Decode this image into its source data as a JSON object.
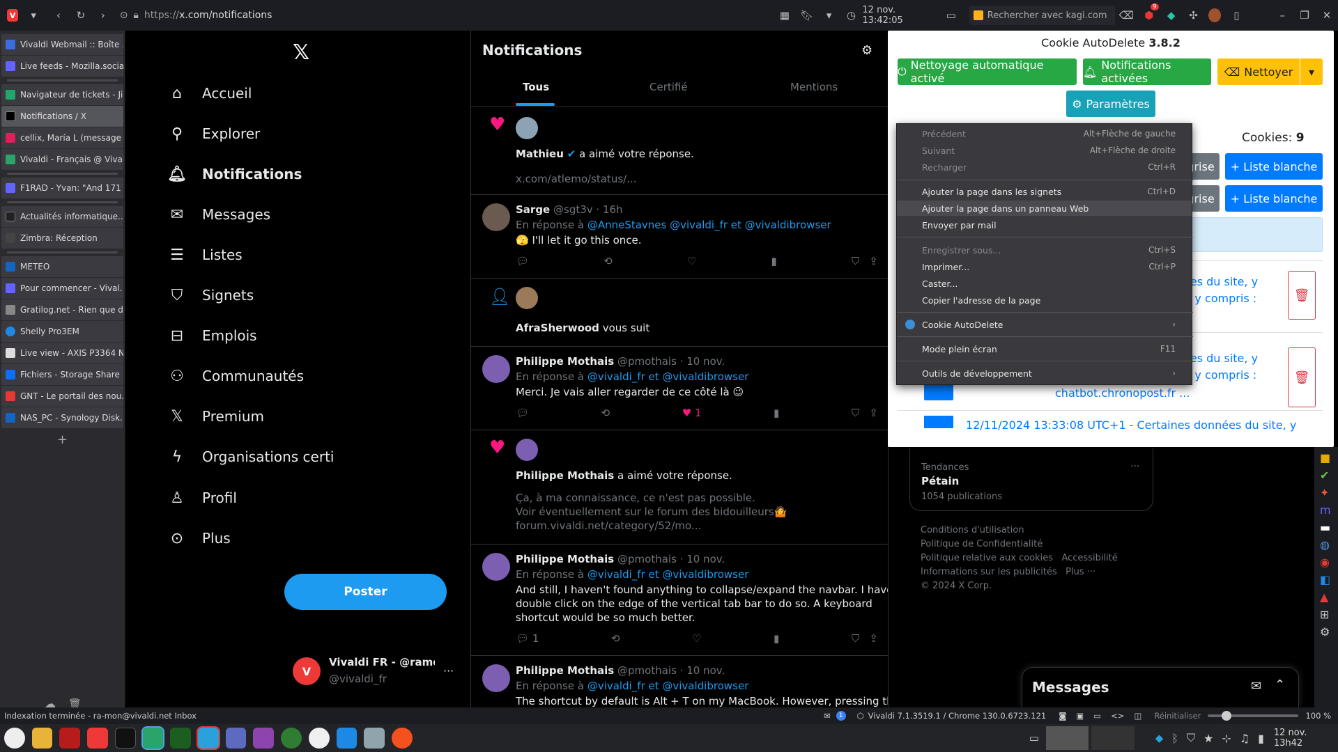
{
  "browser": {
    "url": "https://x.com/notifications",
    "url_prefix": "https://",
    "url_host": "x.com/notifications",
    "datetime": "12 nov. 13:42:05",
    "search_placeholder": "Rechercher avec kagi.com",
    "badge_count": "9"
  },
  "vtabs": [
    {
      "label": "Vivaldi Webmail :: Boîte ...",
      "color": "#3d6cdf"
    },
    {
      "label": "Live feeds - Mozilla.social",
      "color": "#6364ff"
    },
    {
      "label": "Navigateur de tickets - Ji...",
      "color": "#1fa86b"
    },
    {
      "label": "Notifications / X",
      "color": "#000000"
    },
    {
      "label": "cellix, María L (message ...",
      "color": "#e01e5a"
    },
    {
      "label": "Vivaldi - Français @ Vival...",
      "color": "#2aa46a"
    },
    {
      "label": "F1RAD - Yvan: \"And 171 l...",
      "color": "#6364ff"
    },
    {
      "label": "Actualités informatique...",
      "color": "#222222"
    },
    {
      "label": "Zimbra: Réception",
      "color": "#444444"
    },
    {
      "label": "METEO",
      "color": "#1565c0"
    },
    {
      "label": "Pour commencer - Vival...",
      "color": "#6364ff"
    },
    {
      "label": "Gratilog.net - Rien que d...",
      "color": "#888888"
    },
    {
      "label": "Shelly Pro3EM",
      "color": "#1e88e5"
    },
    {
      "label": "Live view - AXIS P3364 N...",
      "color": "#333333"
    },
    {
      "label": "Fichiers - Storage Share",
      "color": "#0d6efd"
    },
    {
      "label": "GNT - Le portail des nou...",
      "color": "#e53935"
    },
    {
      "label": "NAS_PC - Synology Disk...",
      "color": "#1565c0"
    }
  ],
  "nav": {
    "items": [
      "Accueil",
      "Explorer",
      "Notifications",
      "Messages",
      "Listes",
      "Signets",
      "Emplois",
      "Communautés",
      "Premium",
      "Organisations certi",
      "Profil",
      "Plus"
    ],
    "post_button": "Poster",
    "account_name": "Vivaldi FR - @ramon@",
    "account_handle": "@vivaldi_fr"
  },
  "feed": {
    "title": "Notifications",
    "tabs": [
      "Tous",
      "Certifié",
      "Mentions"
    ],
    "n1_name": "Mathieu",
    "n1_text": "a aimé votre réponse.",
    "n1_link": "x.com/atlemo/status/...",
    "p1_name": "Sarge",
    "p1_meta": "@sgt3v · 16h",
    "p1_reply_prefix": "En réponse à",
    "p1_reply_to": "@AnneStavnes @vivaldi_fr  et  @vivaldibrowser",
    "p1_body": "🫣 I'll let it go this once.",
    "n2_name": "AfraSherwood",
    "n2_text": "vous suit",
    "p2_name": "Philippe Mothais",
    "p2_meta": "@pmothais · 10 nov.",
    "p2_reply_to": "@vivaldi_fr  et  @vivaldibrowser",
    "p2_body": "Merci. Je vais aller regarder de ce côté là 😉",
    "p2_likes": "1",
    "n3_name": "Philippe Mothais",
    "n3_text": "a aimé votre réponse.",
    "n3_quote1": "Ça, à ma connaissance, ce n'est pas possible.",
    "n3_quote2": "Voir éventuellement sur le forum des bidouilleurs🤷",
    "n3_quote3": "forum.vivaldi.net/category/52/mo...",
    "p3_name": "Philippe Mothais",
    "p3_meta": "@pmothais · 10 nov.",
    "p3_reply_to": "@vivaldi_fr  et  @vivaldibrowser",
    "p3_body1": "And still, I haven't found anything to collapse/expand the navbar. I have to",
    "p3_body2": "double click on the edge of the vertical tab bar to do so. A keyboard",
    "p3_body3": "shortcut would be so much better.",
    "p3_replies": "1",
    "p4_name": "Philippe Mothais",
    "p4_meta": "@pmothais · 10 nov.",
    "p4_reply_to": "@vivaldi_fr  et  @vivaldibrowser",
    "p4_body": "The shortcut by default is Alt + T on my MacBook. However, pressing those"
  },
  "cookie": {
    "title": "Cookie AutoDelete",
    "version": "3.8.2",
    "btn_auto": "Nettoyage automatique activé",
    "btn_notif": "Notifications activées",
    "btn_clean": "Nettoyer",
    "btn_settings": "Paramètres",
    "cookies_label": "Cookies:",
    "cookies_count": "9",
    "greylist": "grise",
    "whitelist": "+ Liste blanche",
    "log1a": "ées du site, y",
    "log1b": "), y compris :",
    "log2a": "ées du site, y",
    "log2b": "), y compris :",
    "log2c": "chatbot.chronopost.fr ...",
    "log3": "12/11/2024 13:33:08 UTC+1 - Certaines données du site, y",
    "accent_green": "#28a745",
    "accent_orange": "#ffc107",
    "accent_teal": "#17a2b8",
    "accent_blue": "#007bff",
    "accent_red": "#dc3545"
  },
  "context_menu": {
    "items": [
      {
        "label": "Précédent",
        "shortcut": "Alt+Flèche de gauche",
        "disabled": true
      },
      {
        "label": "Suivant",
        "shortcut": "Alt+Flèche de droite",
        "disabled": true
      },
      {
        "label": "Recharger",
        "shortcut": "Ctrl+R",
        "disabled": true
      },
      {
        "label": "Ajouter la page dans les signets",
        "shortcut": "Ctrl+D",
        "disabled": false
      },
      {
        "label": "Ajouter la page dans un panneau Web",
        "shortcut": "",
        "disabled": false
      },
      {
        "label": "Envoyer par mail",
        "shortcut": "",
        "disabled": false
      },
      {
        "label": "Enregistrer sous...",
        "shortcut": "Ctrl+S",
        "disabled": true
      },
      {
        "label": "Imprimer...",
        "shortcut": "Ctrl+P",
        "disabled": false
      },
      {
        "label": "Caster...",
        "shortcut": "",
        "disabled": false
      },
      {
        "label": "Copier l'adresse de la page",
        "shortcut": "",
        "disabled": false
      },
      {
        "label": "Cookie AutoDelete",
        "shortcut": "›",
        "disabled": false
      },
      {
        "label": "Mode plein écran",
        "shortcut": "F11",
        "disabled": false
      },
      {
        "label": "Outils de développement",
        "shortcut": "›",
        "disabled": false
      }
    ]
  },
  "trends": {
    "label": "Tendances",
    "topic": "Pétain",
    "count": "1054 publications"
  },
  "footer": {
    "l1": "Conditions d'utilisation",
    "l2": "Politique de Confidentialité",
    "l3a": "Politique relative aux cookies",
    "l3b": "Accessibilité",
    "l4a": "Informations sur les publicités",
    "l4b": "Plus ···",
    "l5": "© 2024 X Corp."
  },
  "messages_drawer": {
    "title": "Messages"
  },
  "statusbar": {
    "left": "Indexation terminée - ra-mon@vivaldi.net Inbox",
    "mail_count": "1",
    "version": "Vivaldi 7.1.3519.1 / Chrome 130.0.6723.121",
    "reset": "Réinitialiser",
    "zoom": "100 %"
  },
  "taskbar": {
    "clock": "12 nov. 13h42"
  }
}
